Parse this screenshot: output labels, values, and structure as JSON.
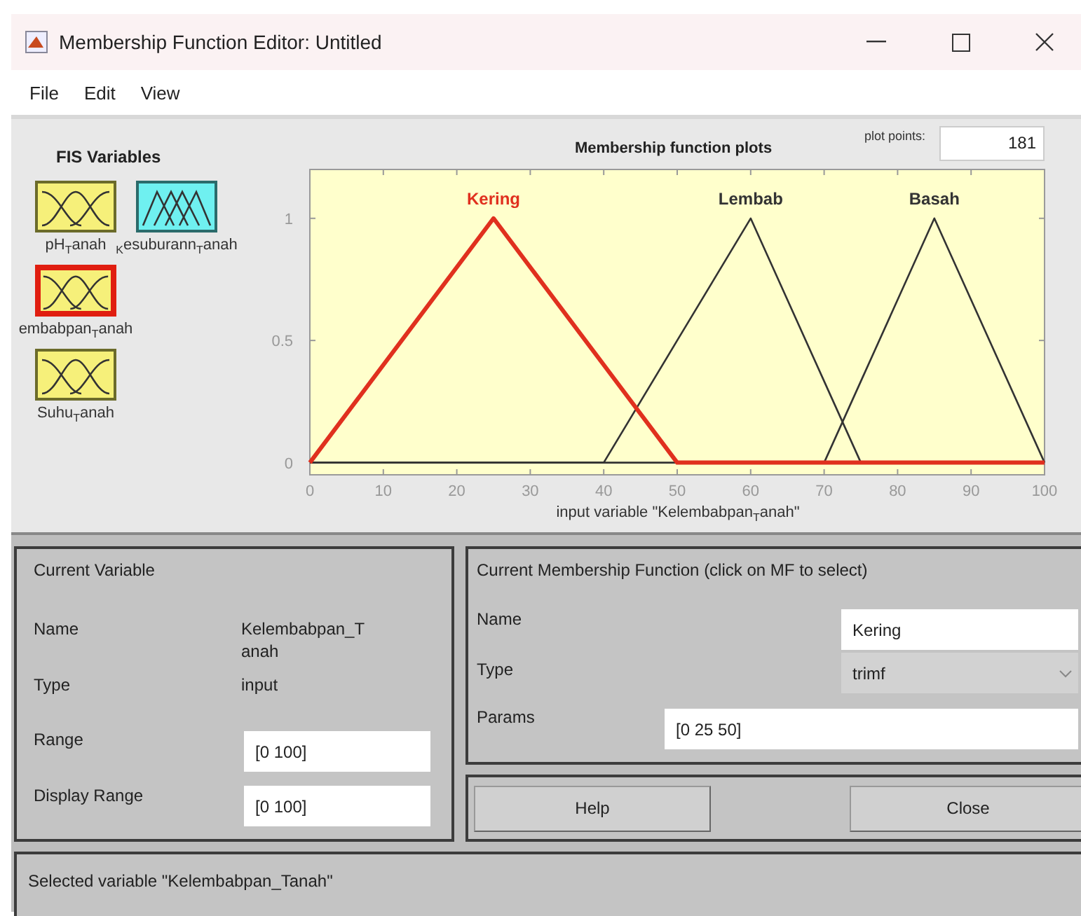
{
  "window": {
    "title": "Membership Function Editor: Untitled"
  },
  "menu": [
    "File",
    "Edit",
    "View"
  ],
  "fis_variables": {
    "title": "FIS Variables",
    "variables": [
      {
        "label": "pH$_{T}$anah",
        "kind": "input",
        "selected": false
      },
      {
        "label": "$_{K}$esuburann$_{T}$anah",
        "kind": "output",
        "selected": false
      },
      {
        "label": "embabpan$_{T}$anah",
        "kind": "input",
        "selected": true
      },
      {
        "label": "Suhu$_{T}$anah",
        "kind": "input",
        "selected": false
      }
    ]
  },
  "plot": {
    "title": "Membership function plots",
    "plot_points_label": "plot points:",
    "plot_points": "181",
    "chart_data": {
      "type": "line",
      "xlabel": "input variable \"Kelembabpan$_{T}$anah\"",
      "x": [
        0,
        25,
        40,
        50,
        60,
        70,
        75,
        85,
        100
      ],
      "xlim": [
        0,
        100
      ],
      "ylim": [
        -0.05,
        1.2
      ],
      "xticks": [
        0,
        10,
        20,
        30,
        40,
        50,
        60,
        70,
        80,
        90,
        100
      ],
      "yticks": [
        0,
        0.5,
        1
      ],
      "series": [
        {
          "name": "Lembab",
          "color": "#333333",
          "values": [
            0,
            0,
            0,
            0.5,
            1,
            0.333,
            0,
            0,
            0
          ]
        },
        {
          "name": "Basah",
          "color": "#333333",
          "values": [
            0,
            0,
            0,
            0,
            0,
            0,
            0.333,
            1,
            0
          ]
        },
        {
          "name": "Kering",
          "color": "#e0301e",
          "values": [
            0,
            1,
            0.4,
            0,
            0,
            0,
            0,
            0,
            0
          ]
        }
      ]
    }
  },
  "current_variable": {
    "title": "Current Variable",
    "name_label": "Name",
    "name": "Kelembabpan_Tanah",
    "type_label": "Type",
    "type": "input",
    "range_label": "Range",
    "range": "[0 100]",
    "display_range_label": "Display Range",
    "display_range": "[0 100]"
  },
  "current_mf": {
    "title": "Current Membership Function (click on MF to select)",
    "name_label": "Name",
    "name": "Kering",
    "type_label": "Type",
    "type": "trimf",
    "params_label": "Params",
    "params": "[0 25 50]"
  },
  "buttons": [
    "Help",
    "Close"
  ],
  "status_bar": "Selected variable \"Kelembabpan_Tanah\""
}
